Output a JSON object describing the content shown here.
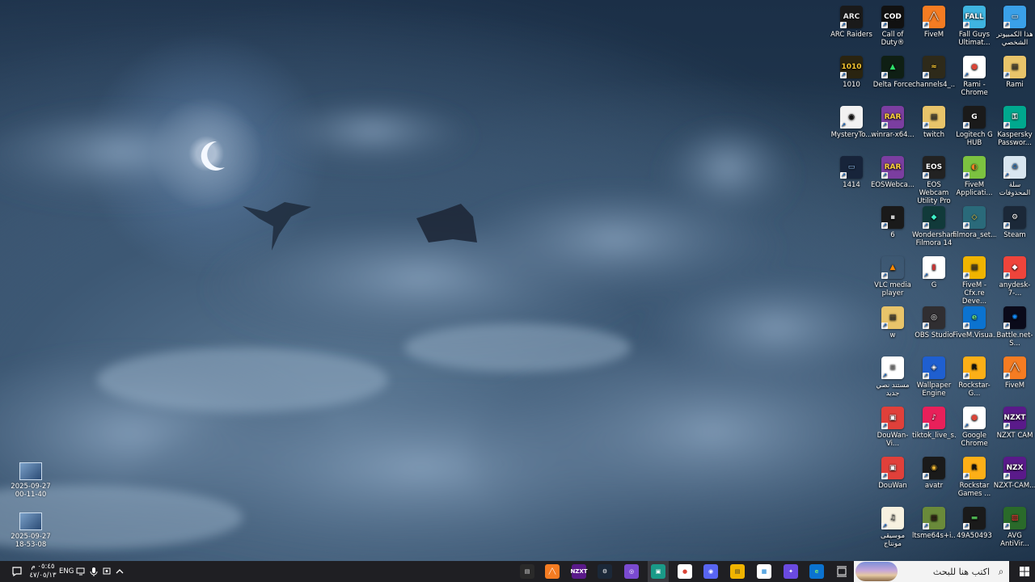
{
  "desktop": {
    "icons_col1": [
      {
        "label": "ARC Raiders",
        "icon": "arc-raiders-icon",
        "bg": "#1a1a1a",
        "fg": "#e8e8e8",
        "glyph": "ARC"
      },
      {
        "label": "1010",
        "icon": "game-icon",
        "bg": "#2a2410",
        "fg": "#f4c430",
        "glyph": "1010"
      },
      {
        "label": "MysteryTo...",
        "icon": "mystery-icon",
        "bg": "#f2f2f2",
        "fg": "#111",
        "glyph": "◉"
      },
      {
        "label": "1414",
        "icon": "file-icon",
        "bg": "#17243a",
        "fg": "#9cf",
        "glyph": "▭"
      }
    ],
    "icons_col2": [
      {
        "label": "Call of Duty®",
        "icon": "call-of-duty-icon",
        "bg": "#111",
        "fg": "#fff",
        "glyph": "COD"
      },
      {
        "label": "Delta Force",
        "icon": "delta-force-icon",
        "bg": "#0f1f14",
        "fg": "#2ee06a",
        "glyph": "▲"
      },
      {
        "label": "winrar-x64...",
        "icon": "winrar-icon",
        "bg": "#7b3ea0",
        "fg": "#ffd23f",
        "glyph": "RAR"
      },
      {
        "label": "EOSWebca...",
        "icon": "winrar-icon",
        "bg": "#7b3ea0",
        "fg": "#ffd23f",
        "glyph": "RAR"
      },
      {
        "label": "6",
        "icon": "file-icon",
        "bg": "#1a1a1a",
        "fg": "#ccc",
        "glyph": "▪"
      },
      {
        "label": "VLC media player",
        "icon": "vlc-icon",
        "bg": "rgba(0,0,0,0)",
        "fg": "#ff8800",
        "glyph": "▲"
      },
      {
        "label": "w",
        "icon": "folder-icon",
        "bg": "#e8c46a",
        "fg": "#333",
        "glyph": "▤"
      },
      {
        "label": "مستند نصي جديد",
        "icon": "text-document-icon",
        "bg": "#ffffff",
        "fg": "#888",
        "glyph": "≡"
      },
      {
        "label": "DouWan-Vi...",
        "icon": "douwan-icon",
        "bg": "#e0403a",
        "fg": "#fff",
        "glyph": "▣"
      },
      {
        "label": "DouWan",
        "icon": "douwan-icon",
        "bg": "#e0403a",
        "fg": "#fff",
        "glyph": "▣"
      },
      {
        "label": "موسيقى مونتاج",
        "icon": "music-folder-icon",
        "bg": "#f7f1e0",
        "fg": "#444",
        "glyph": "♫"
      }
    ],
    "icons_col3": [
      {
        "label": "FiveM",
        "icon": "fivem-icon",
        "bg": "#f57c22",
        "fg": "#fff",
        "glyph": "╱╲"
      },
      {
        "label": "channels4_...",
        "icon": "image-icon",
        "bg": "#2e2a1a",
        "fg": "#fc3",
        "glyph": "≈"
      },
      {
        "label": "twitch",
        "icon": "folder-icon",
        "bg": "#e8c46a",
        "fg": "#333",
        "glyph": "▤"
      },
      {
        "label": "EOS Webcam Utility Pro",
        "icon": "eos-webcam-icon",
        "bg": "#222",
        "fg": "#fff",
        "glyph": "EOS"
      },
      {
        "label": "Wondershare Filmora 14",
        "icon": "filmora-icon",
        "bg": "#113a3a",
        "fg": "#3ef0c8",
        "glyph": "◆"
      },
      {
        "label": "G",
        "icon": "document-icon",
        "bg": "#ffffff",
        "fg": "#c33",
        "glyph": "▮"
      },
      {
        "label": "OBS Studio",
        "icon": "obs-icon",
        "bg": "#302e31",
        "fg": "#fff",
        "glyph": "◎"
      },
      {
        "label": "Wallpaper Engine",
        "icon": "wallpaper-engine-icon",
        "bg": "#1f5fd0",
        "fg": "#fff",
        "glyph": "◈"
      },
      {
        "label": "tiktok_live_s...",
        "icon": "tiktok-icon",
        "bg": "#e8205a",
        "fg": "#fff",
        "glyph": "♪"
      },
      {
        "label": "avatr",
        "icon": "avatr-icon",
        "bg": "#1a1a1a",
        "fg": "#e9b233",
        "glyph": "◉"
      },
      {
        "label": "ltsme64s+i...",
        "icon": "minecraft-icon",
        "bg": "#6a8a3a",
        "fg": "#3a2a1a",
        "glyph": "▦"
      }
    ],
    "icons_col4": [
      {
        "label": "Fall Guys Ultimat...",
        "icon": "fall-guys-icon",
        "bg": "#3fb4e0",
        "fg": "#fff",
        "glyph": "FALL"
      },
      {
        "label": "Rami - Chrome",
        "icon": "chrome-icon",
        "bg": "#ffffff",
        "fg": "#db4437",
        "glyph": "●"
      },
      {
        "label": "Logitech G HUB",
        "icon": "logitech-icon",
        "bg": "#1a1a1a",
        "fg": "#fff",
        "glyph": "G"
      },
      {
        "label": "FiveM Applicati...",
        "icon": "fivem-snail-icon",
        "bg": "#7cc240",
        "fg": "#f57c22",
        "glyph": "◐"
      },
      {
        "label": "filmora_set...",
        "icon": "installer-icon",
        "bg": "#2a6a7a",
        "fg": "#ffd23f",
        "glyph": "◇"
      },
      {
        "label": "FiveM - Cfx.re Deve...",
        "icon": "folder-icon",
        "bg": "#f0b400",
        "fg": "#333",
        "glyph": "▤"
      },
      {
        "label": "FiveM.Visua...",
        "icon": "edge-icon",
        "bg": "#0b73d0",
        "fg": "#6ee07a",
        "glyph": "e"
      },
      {
        "label": "Rockstar-G...",
        "icon": "rockstar-icon",
        "bg": "#fcaf17",
        "fg": "#111",
        "glyph": "R"
      },
      {
        "label": "Google Chrome",
        "icon": "chrome-icon",
        "bg": "#ffffff",
        "fg": "#db4437",
        "glyph": "●"
      },
      {
        "label": "Rockstar Games ...",
        "icon": "rockstar-icon",
        "bg": "#fcaf17",
        "fg": "#111",
        "glyph": "R"
      },
      {
        "label": "49A50493",
        "icon": "image-icon",
        "bg": "#1a1a1a",
        "fg": "#4caf50",
        "glyph": "▬"
      }
    ],
    "icons_col5": [
      {
        "label": "هذا الكمبيوتر الشخصي",
        "icon": "this-pc-icon",
        "bg": "#3aa0e8",
        "fg": "#fff",
        "glyph": "▭"
      },
      {
        "label": "Rami",
        "icon": "user-folder-icon",
        "bg": "#e8c46a",
        "fg": "#333",
        "glyph": "▤"
      },
      {
        "label": "Kaspersky Passwor...",
        "icon": "kaspersky-icon",
        "bg": "#00a88e",
        "fg": "#fff",
        "glyph": "⚿"
      },
      {
        "label": "سلة المحذوفات",
        "icon": "recycle-bin-icon",
        "bg": "#d8e6f0",
        "fg": "#3a7ab8",
        "glyph": "♻"
      },
      {
        "label": "Steam",
        "icon": "steam-icon",
        "bg": "#1b2838",
        "fg": "#fff",
        "glyph": "⚙"
      },
      {
        "label": "anydesk-7-...",
        "icon": "anydesk-icon",
        "bg": "#ef443b",
        "fg": "#fff",
        "glyph": "◆"
      },
      {
        "label": "Battle.net-S...",
        "icon": "battlenet-icon",
        "bg": "#0a0a1a",
        "fg": "#148eff",
        "glyph": "✺"
      },
      {
        "label": "FiveM",
        "icon": "fivem-icon",
        "bg": "#f57c22",
        "fg": "#fff",
        "glyph": "╱╲"
      },
      {
        "label": "NZXT CAM",
        "icon": "nzxt-icon",
        "bg": "#5a1a8a",
        "fg": "#fff",
        "glyph": "NZXT"
      },
      {
        "label": "NZXT-CAM...",
        "icon": "nzxt-icon",
        "bg": "#5a1a8a",
        "fg": "#fff",
        "glyph": "NZX"
      },
      {
        "label": "AVG AntiVir...",
        "icon": "avg-icon",
        "bg": "#2a6a2a",
        "fg": "#ff3b3b",
        "glyph": "▨"
      }
    ],
    "left_icons": [
      {
        "label_line1": "2025-09-27",
        "label_line2": "00-11-40"
      },
      {
        "label_line1": "2025-09-27",
        "label_line2": "18-53-08"
      }
    ]
  },
  "taskbar": {
    "search_placeholder": "اكتب هنا للبحث",
    "language": "ENG",
    "time": "٠٥:٤٥ م",
    "date": "٤٧/٠٥/١٣",
    "pinned": [
      {
        "name": "menu-app-icon",
        "bg": "#2a2a2a",
        "fg": "#ddd",
        "glyph": "▤"
      },
      {
        "name": "fivem-taskbar-icon",
        "bg": "#f57c22",
        "fg": "#fff",
        "glyph": "╱╲"
      },
      {
        "name": "nzxt-taskbar-icon",
        "bg": "#5a1a8a",
        "fg": "#fff",
        "glyph": "NZXT"
      },
      {
        "name": "steam-taskbar-icon",
        "bg": "#1b2838",
        "fg": "#fff",
        "glyph": "⚙"
      },
      {
        "name": "obs-taskbar-icon",
        "bg": "#7a4ad0",
        "fg": "#fff",
        "glyph": "◎"
      },
      {
        "name": "app-taskbar-icon",
        "bg": "#1a9a88",
        "fg": "#fff",
        "glyph": "▣"
      },
      {
        "name": "chrome-taskbar-icon",
        "bg": "#ffffff",
        "fg": "#db4437",
        "glyph": "●"
      },
      {
        "name": "discord-taskbar-icon",
        "bg": "#5865f2",
        "fg": "#fff",
        "glyph": "◉"
      },
      {
        "name": "file-explorer-icon",
        "bg": "#f0b400",
        "fg": "#333",
        "glyph": "▤"
      },
      {
        "name": "store-icon",
        "bg": "#ffffff",
        "fg": "#0078d4",
        "glyph": "▦"
      },
      {
        "name": "copilot-icon",
        "bg": "#6a4ae0",
        "fg": "#fff",
        "glyph": "✦"
      },
      {
        "name": "edge-taskbar-icon",
        "bg": "#0b73d0",
        "fg": "#6ee07a",
        "glyph": "e"
      }
    ]
  }
}
